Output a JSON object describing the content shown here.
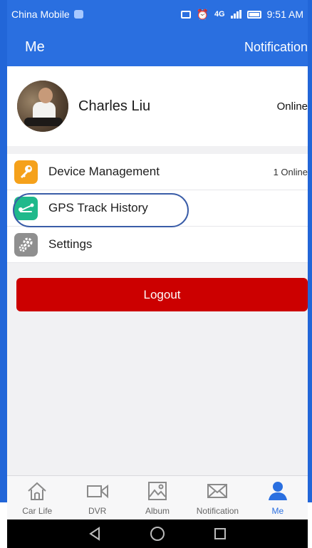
{
  "status_bar": {
    "carrier": "China Mobile",
    "network": "4G",
    "time": "9:51 AM"
  },
  "nav": {
    "title": "Me",
    "right_action": "Notification"
  },
  "profile": {
    "name": "Charles Liu",
    "status": "Online"
  },
  "menu": [
    {
      "label": "Device Management",
      "right_text": "1 Online",
      "icon": "key-icon",
      "color": "#f5a11b"
    },
    {
      "label": "GPS Track History",
      "right_text": "",
      "icon": "route-icon",
      "color": "#1fb98b",
      "highlighted": true
    },
    {
      "label": "Settings",
      "right_text": "",
      "icon": "gears-icon",
      "color": "#8f8f8f"
    }
  ],
  "logout_label": "Logout",
  "tabs": [
    {
      "label": "Car Life",
      "icon": "home-icon"
    },
    {
      "label": "DVR",
      "icon": "video-icon"
    },
    {
      "label": "Album",
      "icon": "image-icon"
    },
    {
      "label": "Notification",
      "icon": "mail-icon"
    },
    {
      "label": "Me",
      "icon": "person-icon",
      "active": true
    }
  ],
  "colors": {
    "accent": "#2a6fe0",
    "logout": "#cc0000"
  }
}
